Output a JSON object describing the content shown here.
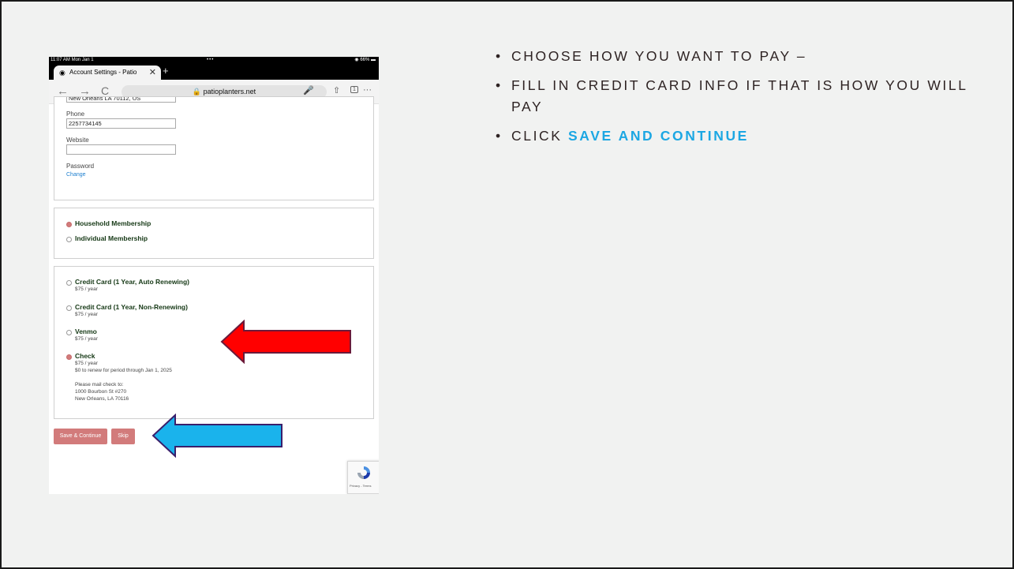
{
  "ipad": {
    "status": {
      "time": "11:07 AM  Mon Jan 1",
      "dots": "•••",
      "battery": "66%"
    },
    "tab": {
      "title": "Account Settings - Patio",
      "close": "✕",
      "new_tab": "+"
    },
    "toolbar": {
      "back": "←",
      "forward": "→",
      "reload": "C",
      "url": "patioplanters.net",
      "tab_count": "1",
      "more": "···"
    },
    "profile": {
      "cut_address": "New Orleans LA 70112, US",
      "phone_label": "Phone",
      "phone_value": "2257734145",
      "website_label": "Website",
      "website_value": "",
      "password_label": "Password",
      "password_link": "Change"
    },
    "membership": {
      "options": [
        {
          "label": "Household Membership",
          "selected": true
        },
        {
          "label": "Individual Membership",
          "selected": false
        }
      ]
    },
    "payment": {
      "options": [
        {
          "label": "Credit Card (1 Year, Auto Renewing)",
          "price": "$75 / year",
          "selected": false
        },
        {
          "label": "Credit Card (1 Year, Non-Renewing)",
          "price": "$75 / year",
          "selected": false
        },
        {
          "label": "Venmo",
          "price": "$75 / year",
          "selected": false
        },
        {
          "label": "Check",
          "price": "$75 / year",
          "renewal": "$0 to renew for period through Jan 1, 2025",
          "selected": true
        }
      ],
      "mail_label": "Please mail check to:",
      "mail_line1": "1000 Bourbon St #270",
      "mail_line2": "New Orleans, LA 70116"
    },
    "buttons": {
      "save": "Save & Continue",
      "skip": "Skip"
    },
    "recaptcha": {
      "terms": "Privacy - Terms"
    }
  },
  "bullets": {
    "items": [
      {
        "text": "Choose how you want to pay –"
      },
      {
        "text": "Fill in credit card info if that is how you will pay"
      },
      {
        "prefix": "Click ",
        "highlight": "Save and continue"
      }
    ],
    "highlight_color": "#1ca7e3"
  },
  "arrows": {
    "red": "#ff0000",
    "blue": "#1ab3ec"
  }
}
